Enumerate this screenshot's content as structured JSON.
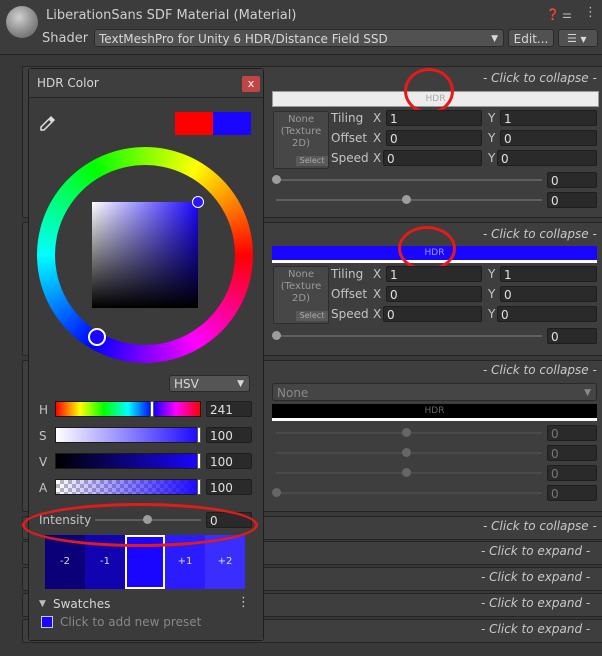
{
  "header": {
    "title": "LiberationSans SDF Material (Material)",
    "shader_label": "Shader",
    "shader_value": "TextMeshPro for Unity 6 HDR/Distance Field SSD",
    "edit_label": "Edit...",
    "icons": [
      "help-icon",
      "sliders-icon",
      "more-icon"
    ]
  },
  "panels": {
    "collapse_label": "- Click to collapse -",
    "expand_label": "- Click to expand -",
    "hdr_label": "HDR",
    "none_label": "None",
    "texture_none": "None\n(Texture\n2D)",
    "select_label": "Select",
    "tiling_label": "Tiling",
    "offset_label": "Offset",
    "speed_label": "Speed",
    "x_label": "X",
    "y_label": "Y",
    "face": {
      "tiling_x": "1",
      "tiling_y": "1",
      "offset_x": "0",
      "offset_y": "0",
      "speed_x": "0",
      "speed_y": "0",
      "slider1": "0",
      "slider2": "0"
    },
    "outline": {
      "tiling_x": "1",
      "tiling_y": "1",
      "offset_x": "0",
      "offset_y": "0",
      "speed_x": "0",
      "speed_y": "0",
      "slider1": "0"
    },
    "underlay": {
      "v1": "0",
      "v2": "0",
      "v3": "0",
      "v4": "0"
    }
  },
  "popup": {
    "title": "HDR Color",
    "close": "x",
    "mode": "HSV",
    "channels": [
      {
        "label": "H",
        "value": "241"
      },
      {
        "label": "S",
        "value": "100"
      },
      {
        "label": "V",
        "value": "100"
      },
      {
        "label": "A",
        "value": "100"
      }
    ],
    "intensity_label": "Intensity",
    "intensity_value": "0",
    "stops": [
      "-2",
      "-1",
      "",
      "+1",
      "+2"
    ],
    "swatches_label": "Swatches",
    "add_preset": "Click to add new preset"
  },
  "colors": {
    "accent_blue": "#1a06ff",
    "red_annotation": "#e31b1b",
    "previous_color": "#ff0000"
  }
}
